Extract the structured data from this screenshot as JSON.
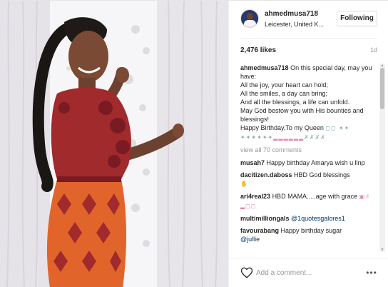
{
  "post": {
    "author": {
      "username": "ahmedmusa718",
      "location": "Leicester, United K...",
      "follow_label": "Following"
    },
    "likes": "2,476 likes",
    "time_ago": "1d",
    "caption": {
      "username": "ahmedmusa718",
      "lines": [
        "On this special day, may you have:",
        "All the joy, your heart can hold;",
        "All the smiles, a day can bring;",
        "And all the blessings, a life can unfold.",
        "May God bestow you with His bounties and blessings!",
        "Happy Birthday,To my Queen"
      ]
    },
    "view_all": "view all 70 comments",
    "comments": [
      {
        "username": "musah7",
        "text": "Happy birthday Amarya wish u llnp"
      },
      {
        "username": "dacitizen.daboss",
        "text": "HBD God blessings"
      },
      {
        "username": "ari4real23",
        "text": "HBD MAMA.....age with grace"
      },
      {
        "username": "multimilliongals",
        "text": "@1quotesgalores1"
      },
      {
        "username": "favourabang",
        "text": "Happy birthday sugar",
        "mention": "@jullie"
      }
    ],
    "add_comment_placeholder": "Add a comment..."
  },
  "icons": {
    "heart": "heart-outline-icon",
    "more": "more-options-icon"
  },
  "colors": {
    "link": "#003569",
    "muted": "#999999",
    "dress_red": "#b0302e",
    "dress_orange": "#e1652b"
  }
}
